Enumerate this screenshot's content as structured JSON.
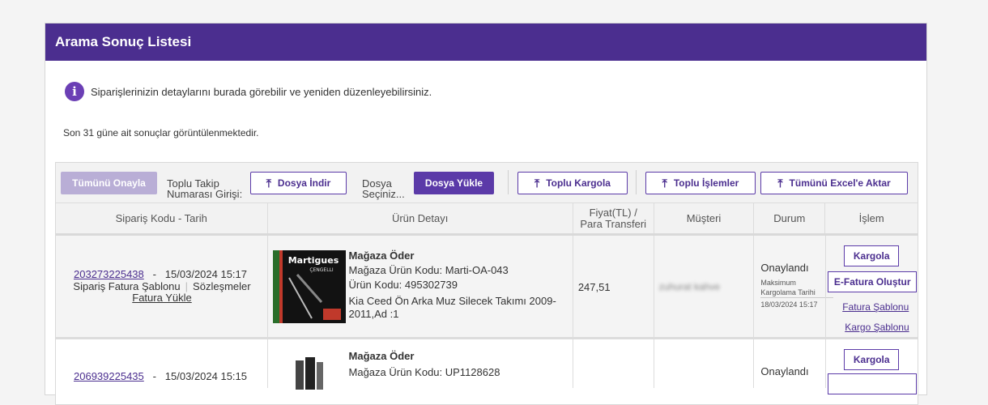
{
  "panel": {
    "title": "Arama Sonuç Listesi"
  },
  "info": {
    "icon": "info-icon",
    "text": "Siparişlerinizin detaylarını burada görebilir ve yeniden düzenleyebilirsiniz."
  },
  "note": "Son 31 güne ait sonuçlar görüntülenmektedir.",
  "toolbar": {
    "approve_all": "Tümünü Onayla",
    "bulk_tracking_label_1": "Toplu Takip",
    "bulk_tracking_label_2": "Numarası Girişi:",
    "download_file": "Dosya İndir",
    "file_select_1": "Dosya",
    "file_select_2": "Seçiniz...",
    "upload_file": "Dosya Yükle",
    "bulk_cargo": "Toplu Kargola",
    "bulk_actions": "Toplu İşlemler",
    "export_excel": "Tümünü Excel'e Aktar"
  },
  "columns": {
    "order": "Sipariş Kodu - Tarih",
    "product": "Ürün Detayı",
    "price_1": "Fiyat(TL) /",
    "price_2": "Para Transferi",
    "customer": "Müşteri",
    "status": "Durum",
    "action": "İşlem"
  },
  "rows": [
    {
      "order_code": "203273225438",
      "date": "15/03/2024 15:17",
      "invoice_template": "Sipariş Fatura Şablonu",
      "contracts": "Sözleşmeler",
      "upload_invoice": "Fatura Yükle",
      "thumb_brand": "Martigues",
      "thumb_sub": "ÇENGELLI",
      "payer": "Mağaza Öder",
      "store_code": "Mağaza Ürün Kodu: Marti-OA-043",
      "product_code": "Ürün Kodu: 495302739",
      "product_name_1": "Kia Ceed Ön Arka Muz Silecek Takımı 2009-",
      "product_name_2": "2011,Ad :1",
      "price": "247,51",
      "customer": "zuhurat kahve",
      "status": "Onaylandı",
      "max_label_1": "Maksimum",
      "max_label_2": "Kargolama Tarihi",
      "max_date": "18/03/2024 15:17",
      "btn_cargo": "Kargola",
      "btn_einvoice": "E-Fatura Oluştur",
      "link_invoice_tpl": "Fatura Şablonu",
      "link_cargo_tpl": "Kargo Şablonu"
    },
    {
      "order_code": "206939225435",
      "date": "15/03/2024 15:15",
      "payer": "Mağaza Öder",
      "store_code": "Mağaza Ürün Kodu: UP1128628",
      "status": "Onaylandı",
      "btn_cargo": "Kargola"
    }
  ]
}
